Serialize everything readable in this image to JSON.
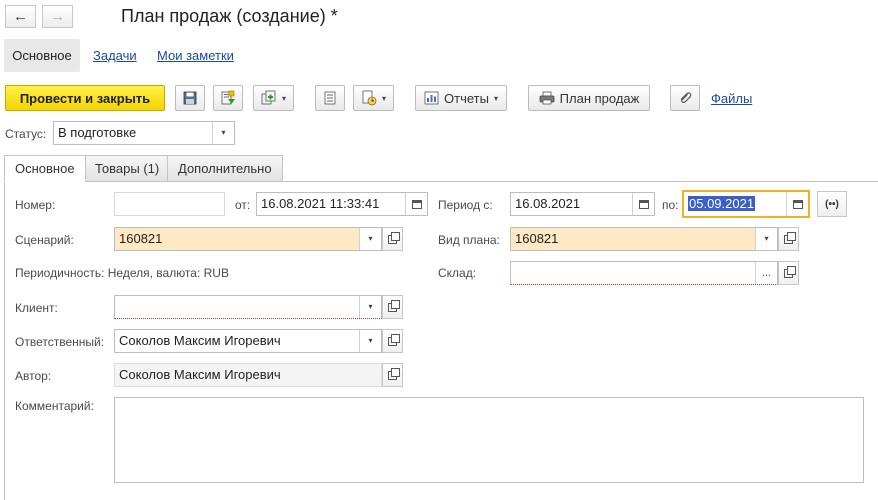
{
  "title": "План продаж (создание) *",
  "nav": {
    "back_icon": "←",
    "forward_icon": "→"
  },
  "sections": {
    "main": "Основное",
    "tasks": "Задачи",
    "notes": "Мои заметки"
  },
  "toolbar": {
    "post_close": "Провести и закрыть",
    "reports": "Отчеты",
    "sales_plan": "План продаж",
    "files": "Файлы"
  },
  "status": {
    "label": "Статус:",
    "value": "В подготовке"
  },
  "tabs": [
    "Основное",
    "Товары (1)",
    "Дополнительно"
  ],
  "form": {
    "number_label": "Номер:",
    "number_value": "",
    "from_label": "от:",
    "from_value": "16.08.2021 11:33:41",
    "period_label": "Период с:",
    "period_from": "16.08.2021",
    "period_to_label": "по:",
    "period_to": "05.09.2021",
    "period_btn": "(••)",
    "scenario_label": "Сценарий:",
    "scenario_value": "160821",
    "plan_type_label": "Вид плана:",
    "plan_type_value": "160821",
    "periodicity_text": "Периодичность: Неделя, валюта: RUB",
    "warehouse_label": "Склад:",
    "warehouse_value": "",
    "client_label": "Клиент:",
    "client_value": "",
    "responsible_label": "Ответственный:",
    "responsible_value": "Соколов Максим Игоревич",
    "author_label": "Автор:",
    "author_value": "Соколов Максим Игоревич",
    "comment_label": "Комментарий:",
    "comment_value": ""
  },
  "icons": {
    "dropdown": "▾",
    "ellipsis": "...",
    "selection_color": "#3a5fc8",
    "accent_yellow": "#f4d400",
    "focus_border": "#f2b21e",
    "required_bg": "#fde9c4"
  }
}
